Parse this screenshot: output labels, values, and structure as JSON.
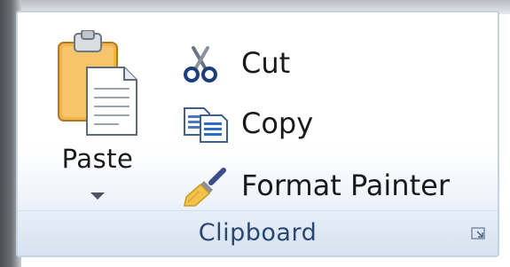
{
  "clipboard": {
    "group_label": "Clipboard",
    "paste": {
      "label": "Paste",
      "icon": "paste-icon"
    },
    "cut": {
      "label": "Cut",
      "icon": "scissors-icon"
    },
    "copy": {
      "label": "Copy",
      "icon": "copy-icon"
    },
    "format_painter": {
      "label": "Format Painter",
      "icon": "paintbrush-icon"
    },
    "launcher_icon": "dialog-launcher-icon"
  },
  "colors": {
    "label_text": "#2a4770",
    "border": "#c5d2e0",
    "footer": "#d6e2f1"
  }
}
